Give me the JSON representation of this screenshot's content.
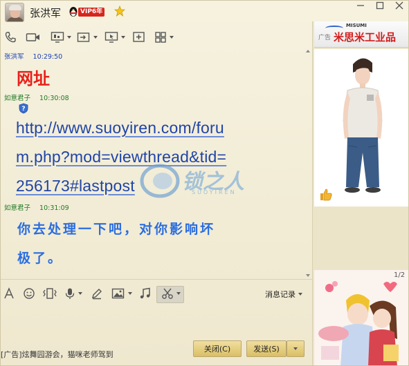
{
  "title": {
    "nickname": "张洪军",
    "vip_badge": "VIP6年",
    "window_buttons": [
      "minimize-icon",
      "maximize-icon",
      "close-icon"
    ]
  },
  "toolbar_icons": [
    "phone-icon",
    "video-icon",
    "screen-share-icon",
    "file-transfer-icon",
    "remote-assist-icon",
    "add-contact-icon",
    "apps-grid-icon"
  ],
  "messages": [
    {
      "sender": "张洪军",
      "time": "10:29:50",
      "text": "网址",
      "color": "#e8201a"
    },
    {
      "sender": "如意君子",
      "time": "10:30:08",
      "link_lines": [
        "http://www.suoyiren.com/foru",
        "m.php?mod=viewthread&tid=",
        "256173#lastpost"
      ],
      "color": "#1f44a8"
    },
    {
      "sender": "如意君子",
      "time": "10:31:09",
      "text_lines": [
        "你去处理一下吧，对你影响坏",
        "极了。"
      ],
      "color": "#2a6de0"
    }
  ],
  "input_toolbar": {
    "icons": [
      "font-icon",
      "emoji-icon",
      "shake-icon",
      "voice-icon",
      "handwriting-icon",
      "image-icon",
      "music-icon",
      "screenshot-scissors-icon"
    ],
    "history_label": "消息记录"
  },
  "bottom": {
    "ad_text": "[广告]炫舞园游会，猫咪老师驾到",
    "close_label": "关闭(C)",
    "send_label": "发送(S)"
  },
  "side_ads": {
    "banner_brand_small": "MISUMI",
    "banner_ad_tag": "广告",
    "banner_brand": "米思米工业品",
    "pager": "1/2"
  },
  "watermark": {
    "text": "锁之人",
    "sub": "SUOYIREN"
  },
  "colors": {
    "sender_self": "#1a3fb4",
    "sender_other": "#217a25",
    "button": "#e3c872"
  }
}
